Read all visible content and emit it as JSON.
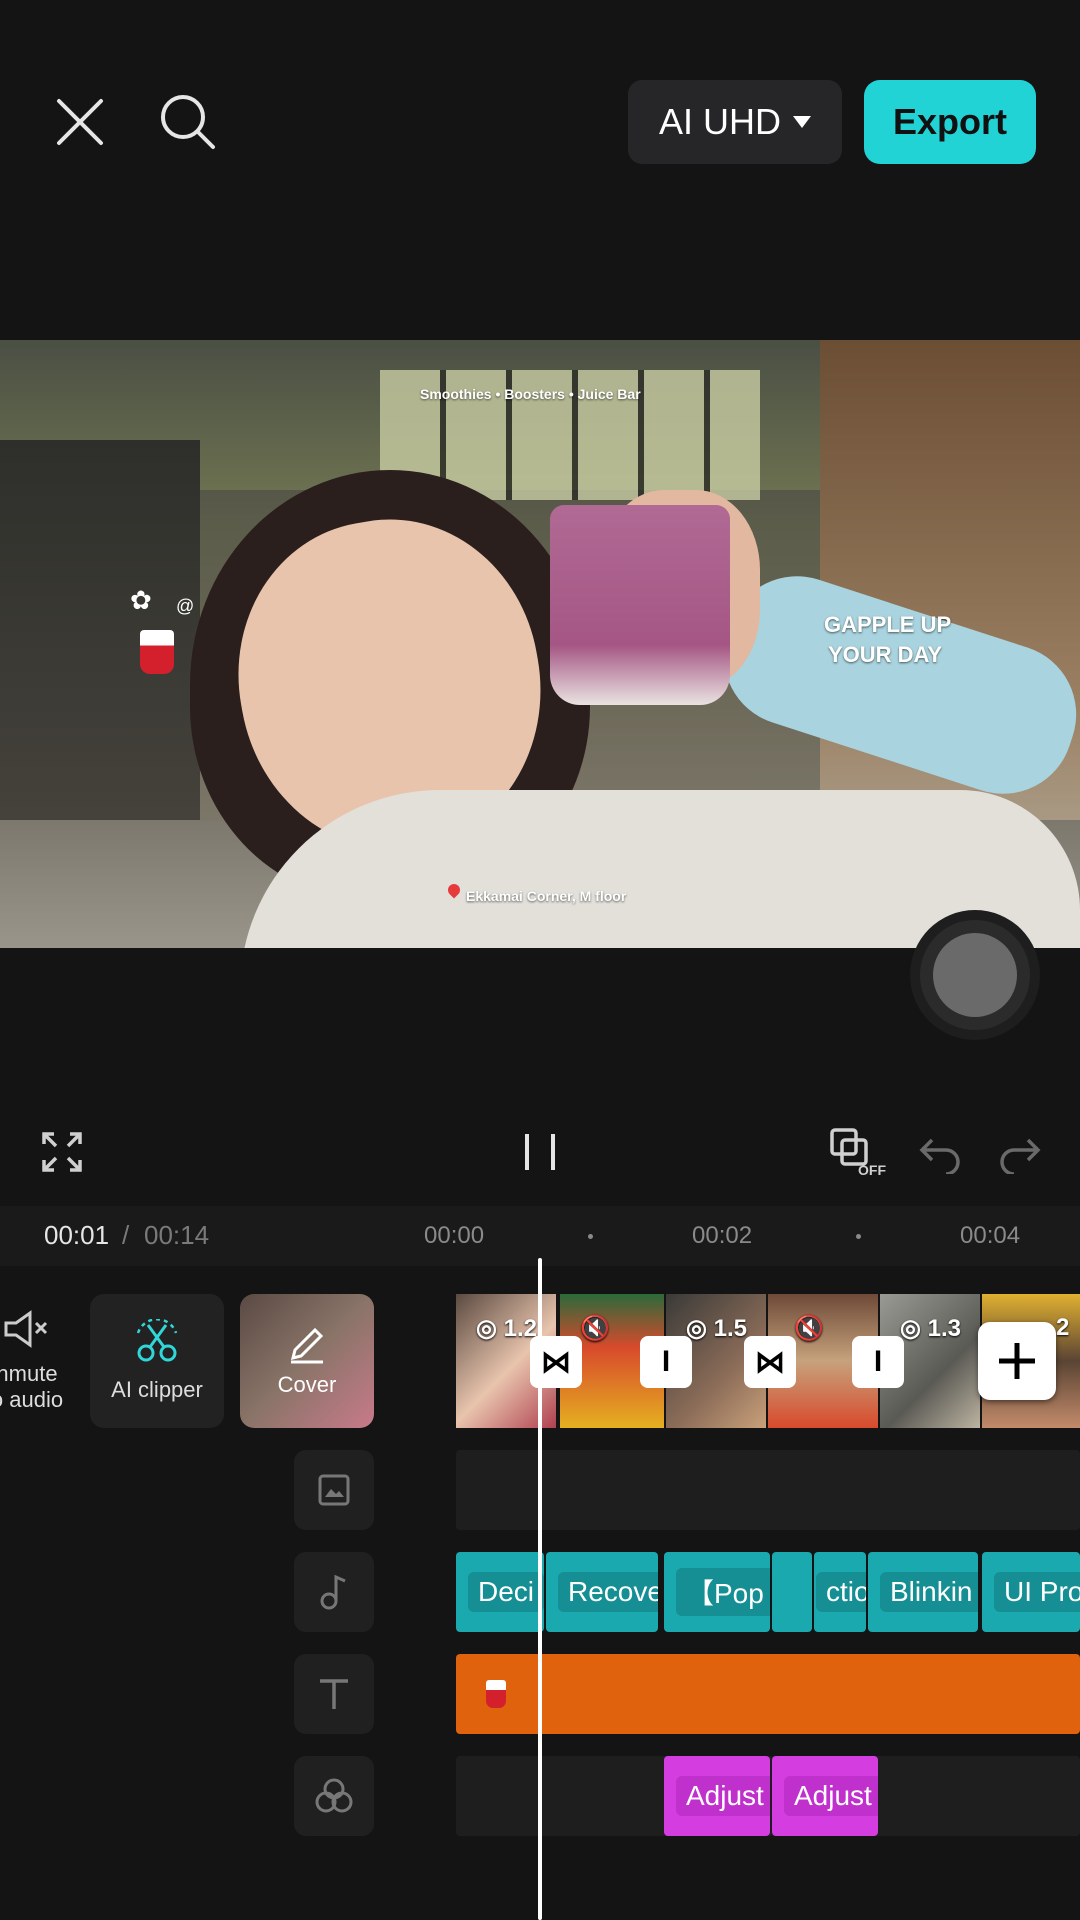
{
  "header": {
    "quality_label": "AI UHD",
    "export_label": "Export"
  },
  "preview": {
    "shop_text": "Smoothies • Boosters • Juice Bar",
    "sticker_text_line1": "GAPPLE UP",
    "sticker_text_line2": "YOUR DAY",
    "location_text": "Ekkamai Corner, M floor"
  },
  "playback": {
    "current_time": "00:01",
    "separator": "/",
    "total_time": "00:14",
    "ruler": [
      "00:00",
      "00:02",
      "00:04"
    ],
    "crop_toggle_state": "OFF"
  },
  "tools": {
    "unmute_label_line1": "nmute",
    "unmute_label_line2": "o audio",
    "ai_clipper_label": "AI clipper",
    "cover_label": "Cover"
  },
  "video_segments": {
    "badges": [
      "1.2",
      "1.5",
      "1.3",
      "2"
    ]
  },
  "audio_clips": [
    "Deci",
    "Recove",
    "【Pop",
    "ction",
    "Blinkin",
    "UI Pro"
  ],
  "text_clip_icon": "cup-sticker",
  "adjust_clips": [
    "Adjust",
    "Adjust"
  ],
  "colors": {
    "accent": "#22d3d6",
    "audio_track": "#1aa9ae",
    "text_track": "#e0620c",
    "adjust_track": "#d43de0",
    "background": "#141414"
  }
}
